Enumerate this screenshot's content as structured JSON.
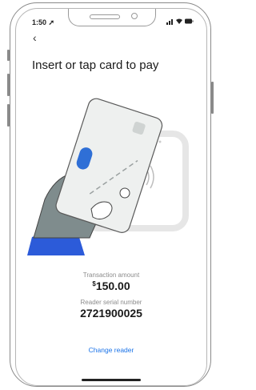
{
  "status": {
    "time": "1:50",
    "icons": "📶 ᯤ ▭"
  },
  "nav": {
    "back_glyph": "‹"
  },
  "main": {
    "title": "Insert or tap card to pay",
    "amount_label": "Transaction amount",
    "amount_currency": "$",
    "amount_value": "150.00",
    "serial_label": "Reader serial number",
    "serial_value": "2721900025",
    "change_reader_label": "Change reader"
  },
  "colors": {
    "accent": "#1a73e8",
    "card_chip": "#2f6fd6",
    "sleeve": "#2c5bd9"
  }
}
